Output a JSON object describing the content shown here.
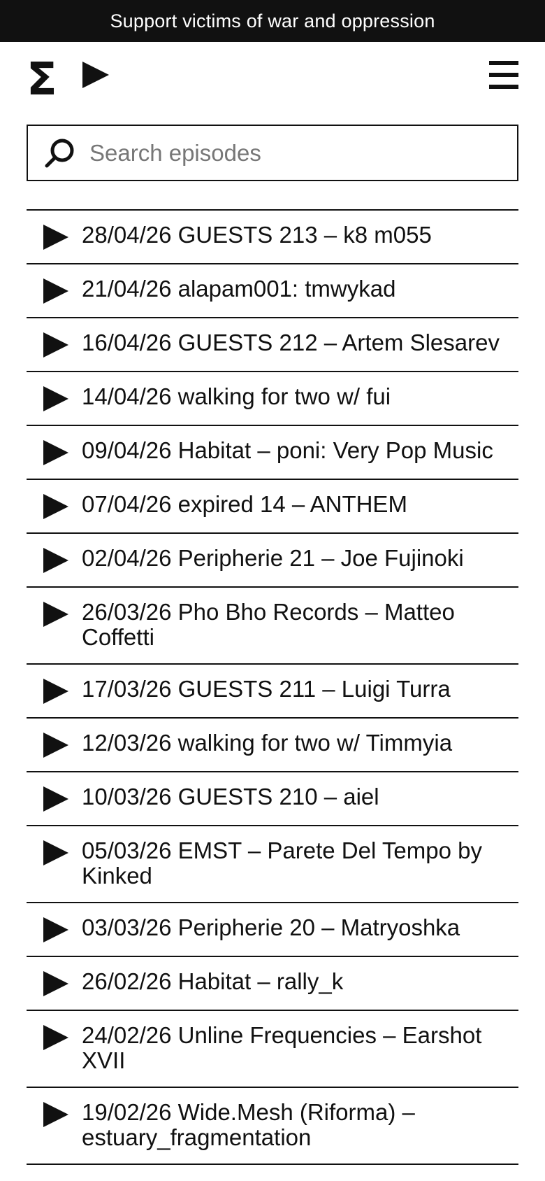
{
  "banner": {
    "text": "Support victims of war and oppression"
  },
  "header": {
    "logo_text": "Σ"
  },
  "search": {
    "placeholder": "Search episodes",
    "value": ""
  },
  "episodes": [
    {
      "title": "28/04/26 GUESTS 213 – k8 m055"
    },
    {
      "title": "21/04/26 alapam001: tmwykad"
    },
    {
      "title": "16/04/26 GUESTS 212 – Artem Slesarev"
    },
    {
      "title": "14/04/26 walking for two w/ fui"
    },
    {
      "title": "09/04/26 Habitat – poni: Very Pop Music"
    },
    {
      "title": "07/04/26 expired 14 – ANTHEM"
    },
    {
      "title": "02/04/26 Peripherie 21 – Joe Fujinoki"
    },
    {
      "title": "26/03/26 Pho Bho Records – Matteo Coffetti"
    },
    {
      "title": "17/03/26 GUESTS 211 – Luigi Turra"
    },
    {
      "title": "12/03/26 walking for two w/ Timmyia"
    },
    {
      "title": "10/03/26 GUESTS 210 – aiel"
    },
    {
      "title": "05/03/26 EMST – Parete Del Tempo by Kinked"
    },
    {
      "title": "03/03/26 Peripherie 20 – Matryoshka"
    },
    {
      "title": "26/02/26 Habitat – rally_k"
    },
    {
      "title": "24/02/26 Unline Frequencies – Earshot XVII"
    },
    {
      "title": "19/02/26 Wide.Mesh (Riforma) – estuary_fragmentation"
    }
  ],
  "colors": {
    "text": "#111111",
    "banner_bg": "#111111",
    "banner_text": "#ffffff",
    "background": "#ffffff",
    "placeholder": "#777777"
  },
  "icons": {
    "logo_play": "play-icon",
    "menu": "hamburger-menu-icon",
    "search": "search-icon",
    "episode_play": "play-icon"
  }
}
